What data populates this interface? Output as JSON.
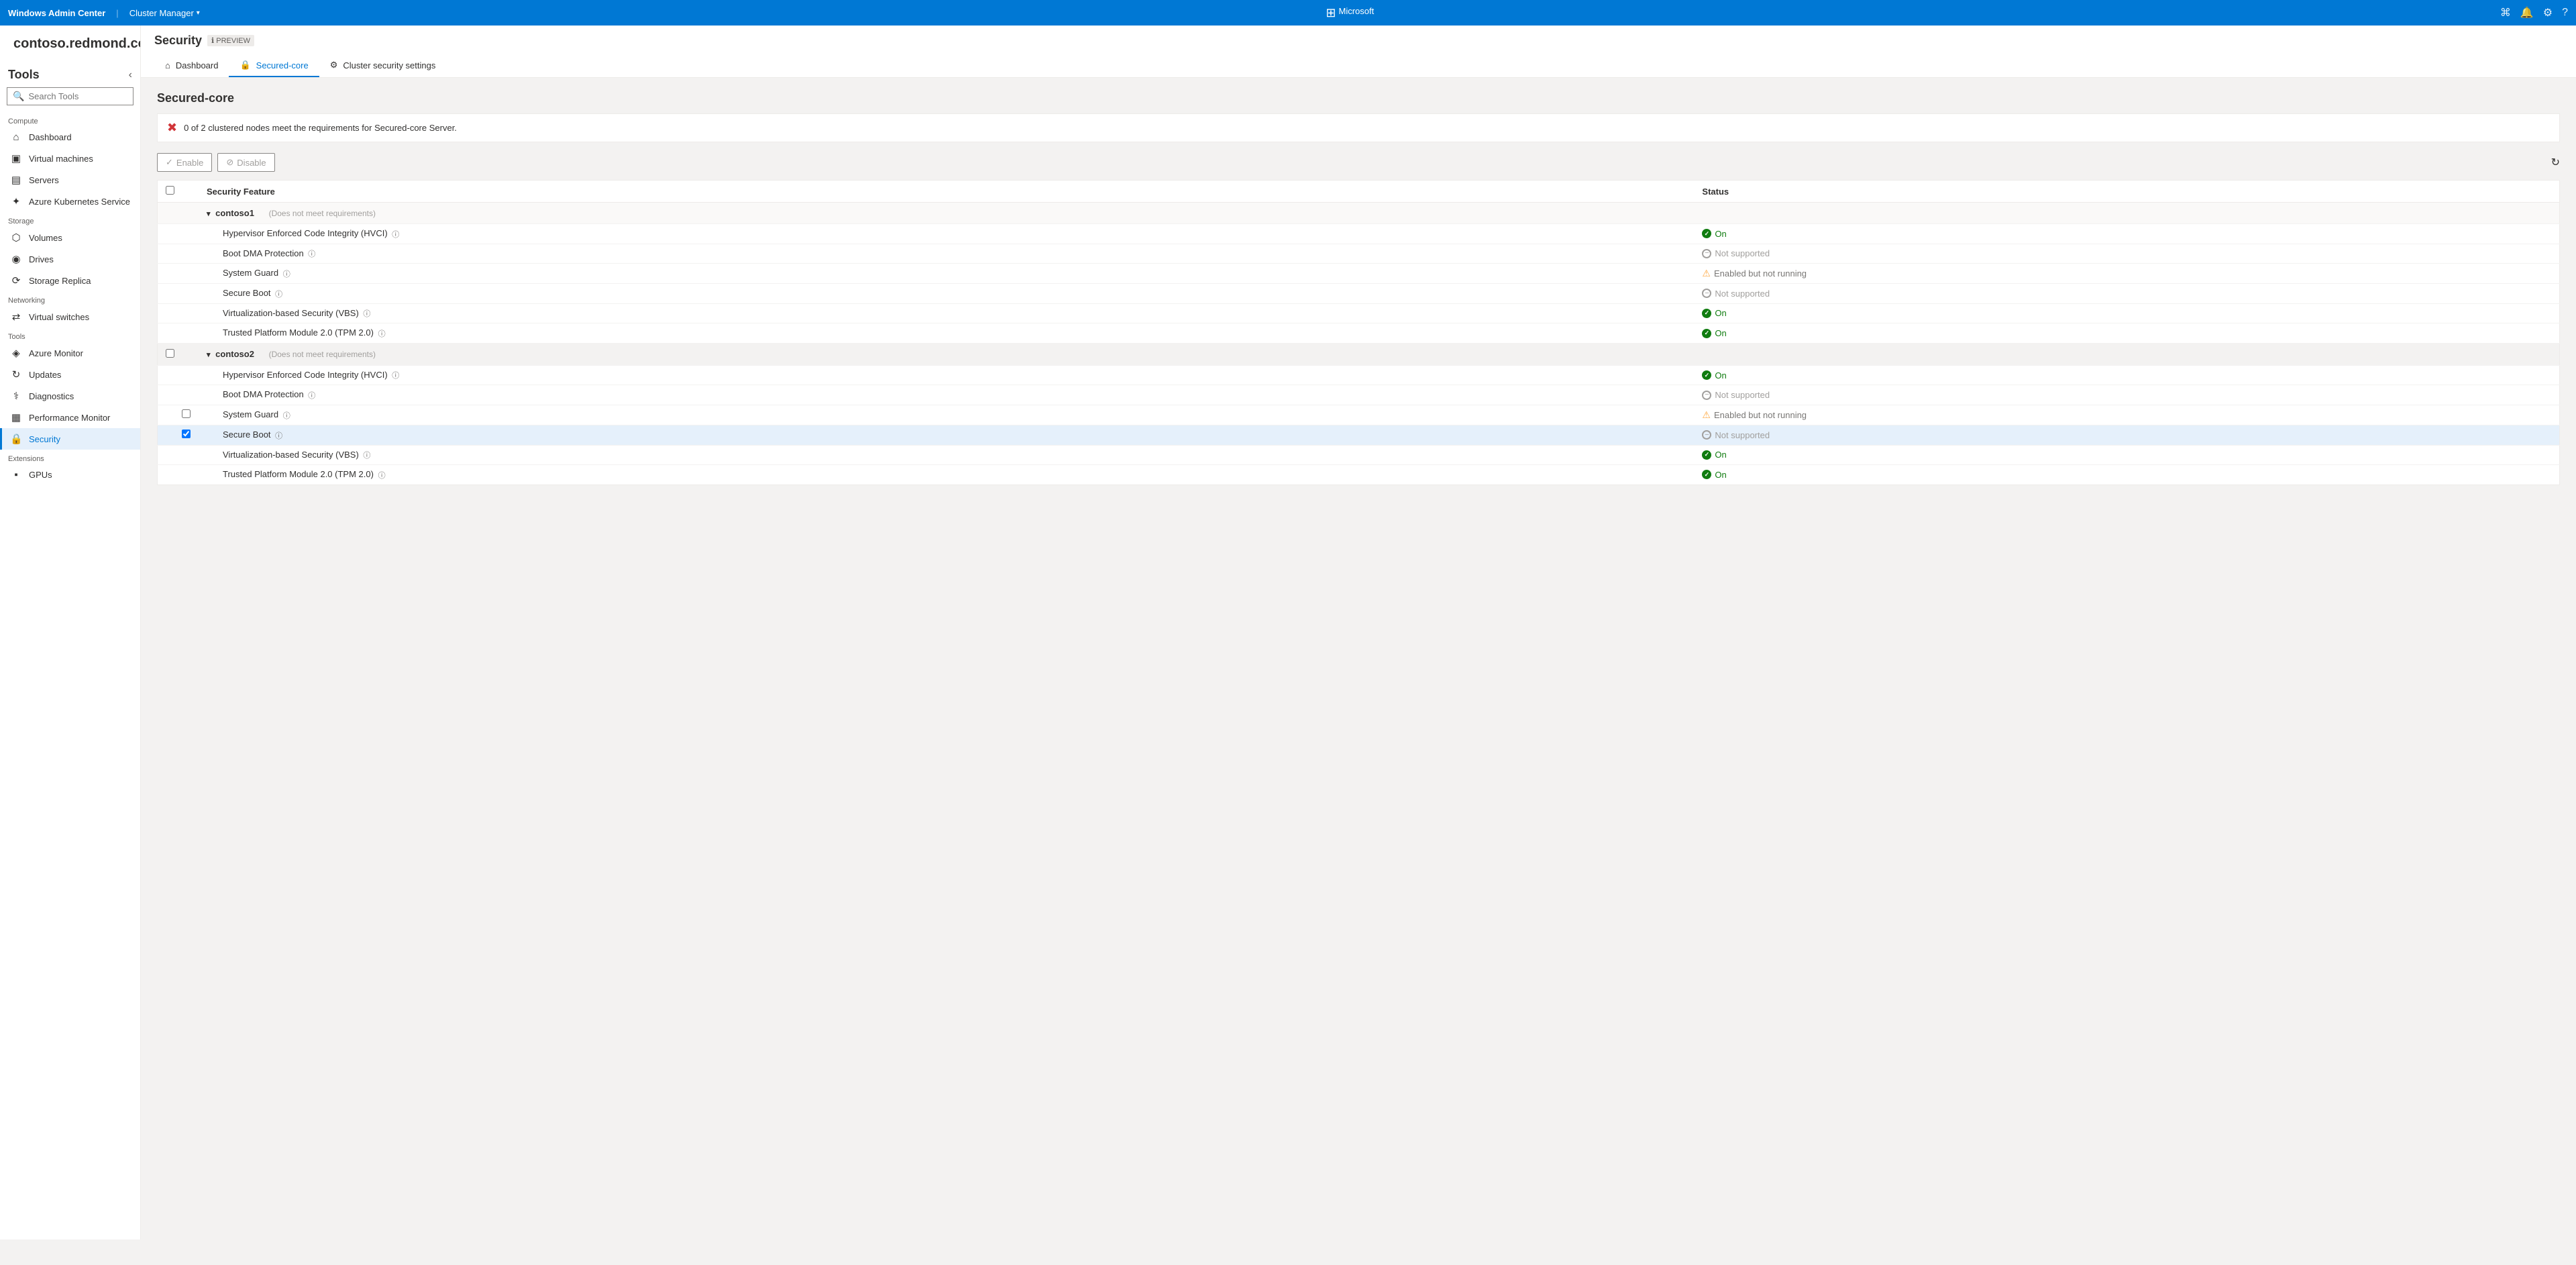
{
  "topbar": {
    "brand": "Windows Admin Center",
    "cluster_manager": "Cluster Manager",
    "ms_logo": "⊞",
    "ms_label": "Microsoft"
  },
  "hostname": "contoso.redmond.corp.microsoft.com",
  "sidebar": {
    "title": "Tools",
    "search_placeholder": "Search Tools",
    "sections": [
      {
        "label": "Compute",
        "items": [
          {
            "id": "dashboard",
            "label": "Dashboard",
            "icon": "⌂"
          },
          {
            "id": "virtual-machines",
            "label": "Virtual machines",
            "icon": "▣"
          },
          {
            "id": "servers",
            "label": "Servers",
            "icon": "▤"
          }
        ]
      },
      {
        "label": "",
        "items": [
          {
            "id": "azure-kubernetes",
            "label": "Azure Kubernetes Service",
            "icon": "✦"
          }
        ]
      },
      {
        "label": "Storage",
        "items": [
          {
            "id": "volumes",
            "label": "Volumes",
            "icon": "⬡"
          },
          {
            "id": "drives",
            "label": "Drives",
            "icon": "◉"
          },
          {
            "id": "storage-replica",
            "label": "Storage Replica",
            "icon": "⟳"
          }
        ]
      },
      {
        "label": "Networking",
        "items": [
          {
            "id": "virtual-switches",
            "label": "Virtual switches",
            "icon": "⇄"
          }
        ]
      },
      {
        "label": "Tools",
        "items": [
          {
            "id": "azure-monitor",
            "label": "Azure Monitor",
            "icon": "◈"
          },
          {
            "id": "updates",
            "label": "Updates",
            "icon": "↻"
          },
          {
            "id": "diagnostics",
            "label": "Diagnostics",
            "icon": "⚕"
          },
          {
            "id": "performance-monitor",
            "label": "Performance Monitor",
            "icon": "▦"
          },
          {
            "id": "security",
            "label": "Security",
            "icon": "🔒",
            "active": true
          }
        ]
      },
      {
        "label": "Extensions",
        "items": [
          {
            "id": "gpus",
            "label": "GPUs",
            "icon": "▪"
          }
        ]
      }
    ]
  },
  "security_page": {
    "title": "Security",
    "preview_label": "PREVIEW",
    "nav": [
      {
        "id": "dashboard",
        "label": "Dashboard",
        "icon": "⌂"
      },
      {
        "id": "secured-core",
        "label": "Secured-core",
        "icon": "🔒",
        "active": true
      },
      {
        "id": "cluster-security-settings",
        "label": "Cluster security settings",
        "icon": "⚙"
      }
    ],
    "section_title": "Secured-core",
    "alert": "0 of 2 clustered nodes meet the requirements for Secured-core Server.",
    "toolbar": {
      "enable_label": "Enable",
      "disable_label": "Disable"
    },
    "table": {
      "col_feature": "Security Feature",
      "col_status": "Status",
      "nodes": [
        {
          "id": "contoso1",
          "label": "contoso1",
          "status_label": "(Does not meet requirements)",
          "features": [
            {
              "name": "Hypervisor Enforced Code Integrity (HVCI)",
              "status": "on",
              "status_label": "On"
            },
            {
              "name": "Boot DMA Protection",
              "status": "not-supported",
              "status_label": "Not supported"
            },
            {
              "name": "System Guard",
              "status": "warning",
              "status_label": "Enabled but not running"
            },
            {
              "name": "Secure Boot",
              "status": "not-supported",
              "status_label": "Not supported"
            },
            {
              "name": "Virtualization-based Security (VBS)",
              "status": "on",
              "status_label": "On"
            },
            {
              "name": "Trusted Platform Module 2.0 (TPM 2.0)",
              "status": "on",
              "status_label": "On"
            }
          ]
        },
        {
          "id": "contoso2",
          "label": "contoso2",
          "status_label": "(Does not meet requirements)",
          "features": [
            {
              "name": "Hypervisor Enforced Code Integrity (HVCI)",
              "status": "on",
              "status_label": "On"
            },
            {
              "name": "Boot DMA Protection",
              "status": "not-supported",
              "status_label": "Not supported"
            },
            {
              "name": "System Guard",
              "status": "warning",
              "status_label": "Enabled but not running"
            },
            {
              "name": "Secure Boot",
              "status": "not-supported",
              "status_label": "Not supported"
            },
            {
              "name": "Virtualization-based Security (VBS)",
              "status": "on",
              "status_label": "On"
            },
            {
              "name": "Trusted Platform Module 2.0 (TPM 2.0)",
              "status": "on",
              "status_label": "On"
            }
          ]
        }
      ]
    }
  }
}
